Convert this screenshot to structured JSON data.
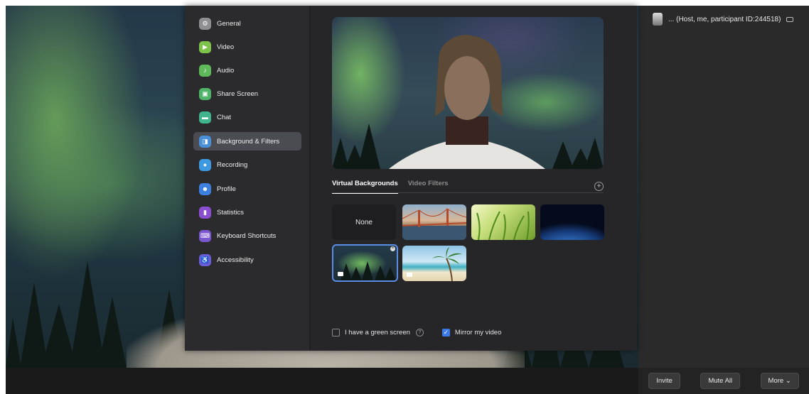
{
  "settings": {
    "nav": [
      {
        "label": "General",
        "icon": "gear-icon",
        "color": "#8e8e93"
      },
      {
        "label": "Video",
        "icon": "video-camera-icon",
        "color": "#7ec44a"
      },
      {
        "label": "Audio",
        "icon": "headphones-icon",
        "color": "#5fb85a"
      },
      {
        "label": "Share Screen",
        "icon": "share-screen-icon",
        "color": "#4fb36a"
      },
      {
        "label": "Chat",
        "icon": "chat-bubble-icon",
        "color": "#3fb48d"
      },
      {
        "label": "Background & Filters",
        "icon": "portrait-icon",
        "color": "#4a90d9"
      },
      {
        "label": "Recording",
        "icon": "record-icon",
        "color": "#3e9ae0"
      },
      {
        "label": "Profile",
        "icon": "profile-icon",
        "color": "#3c7fe0"
      },
      {
        "label": "Statistics",
        "icon": "bar-chart-icon",
        "color": "#8a4fd0"
      },
      {
        "label": "Keyboard Shortcuts",
        "icon": "keyboard-icon",
        "color": "#7a57cf"
      },
      {
        "label": "Accessibility",
        "icon": "accessibility-icon",
        "color": "#6a5ed8"
      }
    ],
    "active_nav": "Background & Filters",
    "tabs": {
      "virtual_backgrounds": "Virtual Backgrounds",
      "video_filters": "Video Filters"
    },
    "add_icon": "plus-circle-icon",
    "backgrounds": {
      "none_label": "None",
      "selected": "aurora"
    },
    "options": {
      "green_screen_label": "I have a green screen",
      "green_screen_checked": false,
      "mirror_label": "Mirror my video",
      "mirror_checked": true,
      "help_icon": "question-circle-icon"
    }
  },
  "participants": {
    "row_text": "... (Host, me, participant ID:244518)"
  },
  "footer": {
    "invite": "Invite",
    "mute_all": "Mute All",
    "more": "More ⌄"
  },
  "colors": {
    "accent": "#3b7ae8",
    "panel": "#2a2a2a",
    "dialog": "#262628"
  }
}
